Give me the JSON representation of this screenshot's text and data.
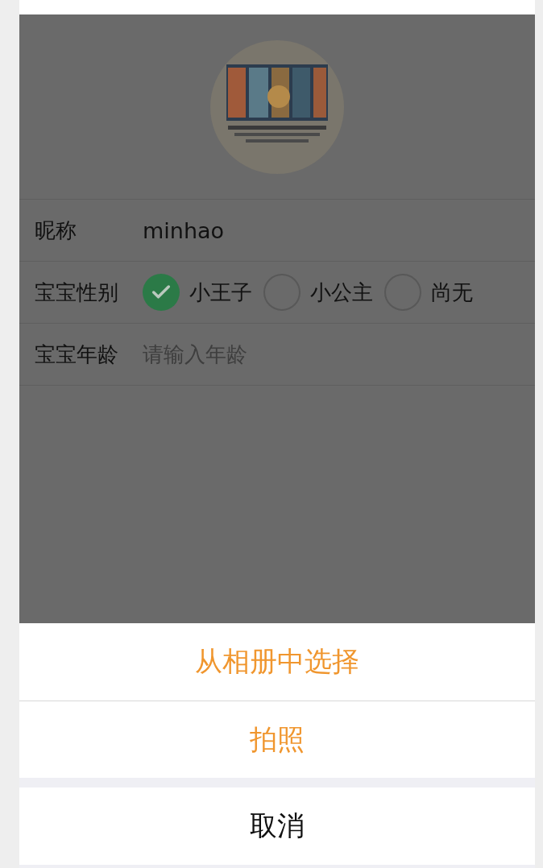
{
  "profile": {
    "fields": [
      {
        "kind": "text",
        "label": "昵称",
        "value": "minhao"
      },
      {
        "kind": "radio",
        "label": "宝宝性别",
        "options": [
          {
            "label": "小王子",
            "selected": true
          },
          {
            "label": "小公主",
            "selected": false
          },
          {
            "label": "尚无",
            "selected": false
          }
        ]
      },
      {
        "kind": "input",
        "label": "宝宝年龄",
        "placeholder": "请输入年龄"
      }
    ]
  },
  "action_sheet": {
    "options": [
      {
        "kind": "action",
        "label": "从相册中选择"
      },
      {
        "kind": "action",
        "label": "拍照"
      }
    ],
    "cancel": "取消"
  }
}
